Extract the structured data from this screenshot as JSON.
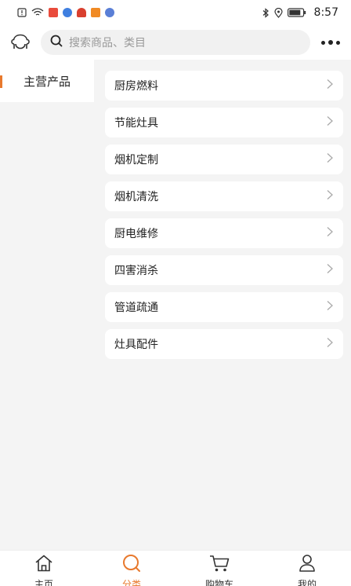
{
  "status_bar": {
    "time": "8:57",
    "left_icons": [
      "alert-icon",
      "wifi-icon",
      "app-badge-icon",
      "app-icon",
      "app-icon",
      "video-icon",
      "app-icon"
    ],
    "right_icons": [
      "bluetooth-icon",
      "location-icon",
      "battery-icon"
    ]
  },
  "header": {
    "logo_icon": "customer-service-icon",
    "search_placeholder": "搜索商品、类目",
    "more_icon": "more-dots-icon"
  },
  "side_nav": {
    "items": [
      {
        "label": "主营产品",
        "active": true
      }
    ]
  },
  "categories": [
    {
      "label": "厨房燃料"
    },
    {
      "label": "节能灶具"
    },
    {
      "label": "烟机定制"
    },
    {
      "label": "烟机清洗"
    },
    {
      "label": "厨电维修"
    },
    {
      "label": "四害消杀"
    },
    {
      "label": "管道疏通"
    },
    {
      "label": "灶具配件"
    }
  ],
  "tab_bar": {
    "tabs": [
      {
        "label": "主页",
        "icon": "home-icon"
      },
      {
        "label": "分类",
        "icon": "category-search-icon",
        "active": true
      },
      {
        "label": "购物车",
        "icon": "cart-icon"
      },
      {
        "label": "我的",
        "icon": "user-icon"
      }
    ]
  },
  "colors": {
    "accent": "#e8792d",
    "background": "#f4f4f4",
    "card": "#ffffff"
  }
}
